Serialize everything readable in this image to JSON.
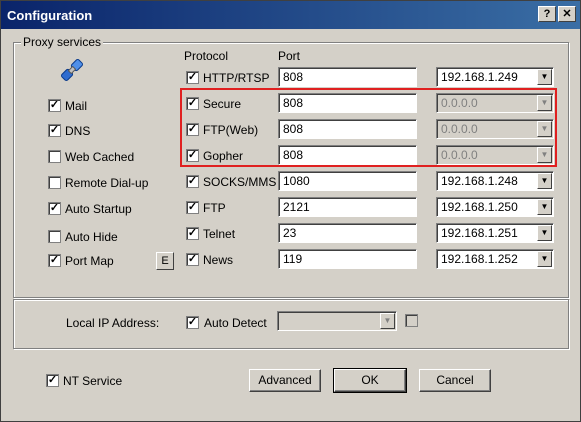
{
  "window": {
    "title": "Configuration",
    "help": "?",
    "close": "✕"
  },
  "group": {
    "legend": "Proxy services"
  },
  "headers": {
    "protocol": "Protocol",
    "port": "Port"
  },
  "left_options": {
    "mail": "Mail",
    "dns": "DNS",
    "web_cached": "Web Cached",
    "remote_dialup": "Remote Dial-up",
    "auto_startup": "Auto Startup",
    "auto_hide": "Auto Hide",
    "port_map": "Port Map",
    "port_map_edit": "E"
  },
  "protocols": [
    {
      "name": "HTTP/RTSP",
      "port": "808",
      "ip": "192.168.1.249",
      "checked": true
    },
    {
      "name": "Secure",
      "port": "808",
      "ip": "0.0.0.0",
      "checked": true
    },
    {
      "name": "FTP(Web)",
      "port": "808",
      "ip": "0.0.0.0",
      "checked": true
    },
    {
      "name": "Gopher",
      "port": "808",
      "ip": "0.0.0.0",
      "checked": true
    },
    {
      "name": "SOCKS/MMS",
      "port": "1080",
      "ip": "192.168.1.248",
      "checked": true
    },
    {
      "name": "FTP",
      "port": "2121",
      "ip": "192.168.1.250",
      "checked": true
    },
    {
      "name": "Telnet",
      "port": "23",
      "ip": "192.168.1.251",
      "checked": true
    },
    {
      "name": "News",
      "port": "119",
      "ip": "192.168.1.252",
      "checked": true
    }
  ],
  "local_ip": {
    "label": "Local IP Address:",
    "auto_detect": "Auto Detect"
  },
  "bottom": {
    "nt_service": "NT Service",
    "advanced": "Advanced",
    "ok": "OK",
    "cancel": "Cancel"
  },
  "check_mark": "✓",
  "arrow": "▼",
  "colors": {
    "highlight": "#e02020",
    "title_bg": "#0a246a"
  }
}
